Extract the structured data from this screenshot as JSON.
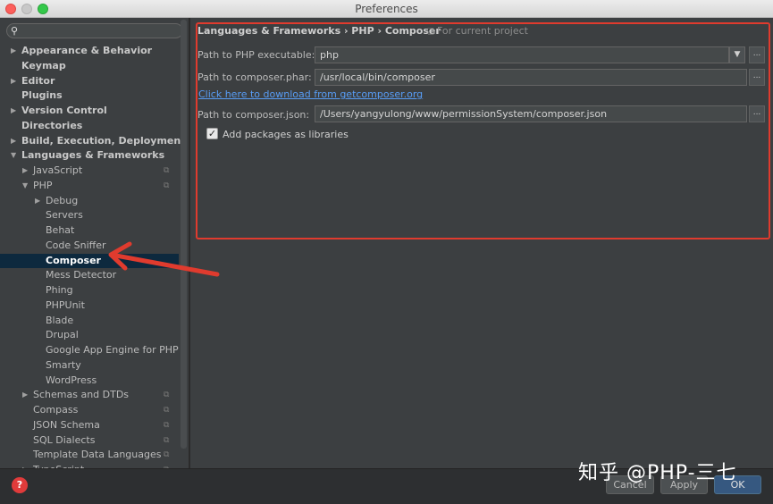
{
  "window": {
    "title": "Preferences"
  },
  "search": {
    "placeholder": ""
  },
  "sidebar": {
    "items": [
      {
        "label": "Appearance & Behavior",
        "level": 0,
        "arrow": "right",
        "bold": true
      },
      {
        "label": "Keymap",
        "level": 0,
        "arrow": "none",
        "bold": true
      },
      {
        "label": "Editor",
        "level": 0,
        "arrow": "right",
        "bold": true
      },
      {
        "label": "Plugins",
        "level": 0,
        "arrow": "none",
        "bold": true
      },
      {
        "label": "Version Control",
        "level": 0,
        "arrow": "right",
        "bold": true
      },
      {
        "label": "Directories",
        "level": 0,
        "arrow": "none",
        "bold": true
      },
      {
        "label": "Build, Execution, Deployment",
        "level": 0,
        "arrow": "right",
        "bold": true
      },
      {
        "label": "Languages & Frameworks",
        "level": 0,
        "arrow": "down",
        "bold": true
      },
      {
        "label": "JavaScript",
        "level": 1,
        "arrow": "right",
        "copy": true
      },
      {
        "label": "PHP",
        "level": 1,
        "arrow": "down",
        "copy": true
      },
      {
        "label": "Debug",
        "level": 2,
        "arrow": "right"
      },
      {
        "label": "Servers",
        "level": 2,
        "arrow": "none"
      },
      {
        "label": "Behat",
        "level": 2,
        "arrow": "none"
      },
      {
        "label": "Code Sniffer",
        "level": 2,
        "arrow": "none"
      },
      {
        "label": "Composer",
        "level": 2,
        "arrow": "none",
        "selected": true
      },
      {
        "label": "Mess Detector",
        "level": 2,
        "arrow": "none"
      },
      {
        "label": "Phing",
        "level": 2,
        "arrow": "none"
      },
      {
        "label": "PHPUnit",
        "level": 2,
        "arrow": "none"
      },
      {
        "label": "Blade",
        "level": 2,
        "arrow": "none"
      },
      {
        "label": "Drupal",
        "level": 2,
        "arrow": "none"
      },
      {
        "label": "Google App Engine for PHP",
        "level": 2,
        "arrow": "none"
      },
      {
        "label": "Smarty",
        "level": 2,
        "arrow": "none"
      },
      {
        "label": "WordPress",
        "level": 2,
        "arrow": "none"
      },
      {
        "label": "Schemas and DTDs",
        "level": 1,
        "arrow": "right",
        "copy": true
      },
      {
        "label": "Compass",
        "level": 1,
        "arrow": "none",
        "copy": true
      },
      {
        "label": "JSON Schema",
        "level": 1,
        "arrow": "none",
        "copy": true
      },
      {
        "label": "SQL Dialects",
        "level": 1,
        "arrow": "none",
        "copy": true
      },
      {
        "label": "Template Data Languages",
        "level": 1,
        "arrow": "none",
        "copy": true
      },
      {
        "label": "TypeScript",
        "level": 1,
        "arrow": "right",
        "copy": true
      }
    ]
  },
  "content": {
    "breadcrumb": "Languages & Frameworks › PHP › Composer",
    "scope_note": "For current project",
    "php_exec_label": "Path to PHP executable:",
    "php_exec_value": "php",
    "phar_label": "Path to composer.phar:",
    "phar_value": "/usr/local/bin/composer",
    "download_link": "Click here to download from getcomposer.org",
    "json_label": "Path to composer.json:",
    "json_value": "/Users/yangyulong/www/permissionSystem/composer.json",
    "add_packages_label": "Add packages as libraries",
    "add_packages_checked": true,
    "browse_label": "..."
  },
  "footer": {
    "help_label": "?",
    "cancel_label": "Cancel",
    "apply_label": "Apply",
    "ok_label": "OK"
  },
  "watermark": "知乎 @PHP-三七",
  "colors": {
    "highlight_box": "#e03b2e",
    "arrow": "#e03b2e",
    "selection": "#0d293e",
    "link": "#589df6"
  }
}
